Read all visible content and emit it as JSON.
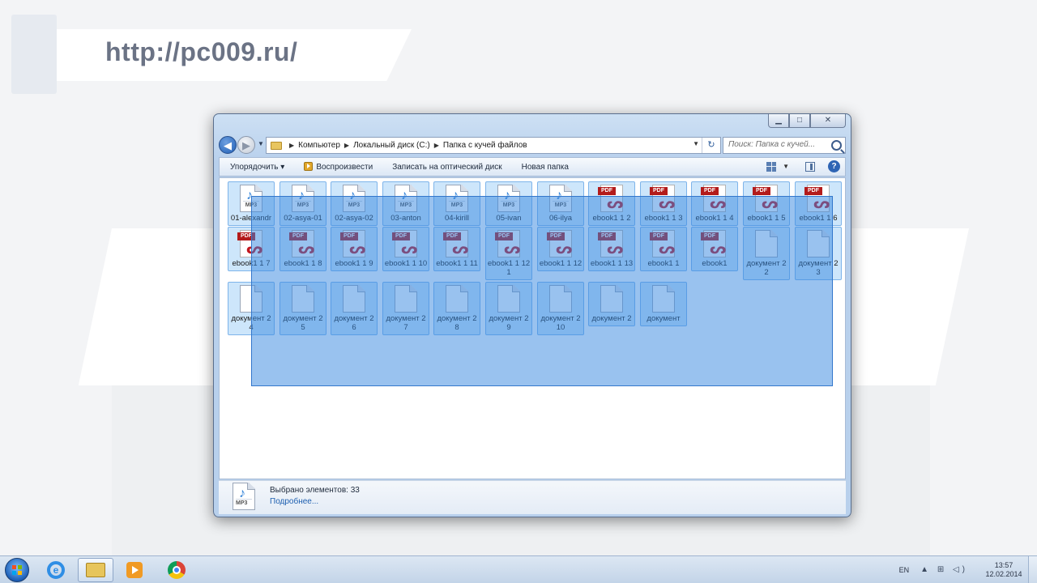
{
  "banner": {
    "url": "http://pc009.ru/"
  },
  "window": {
    "caption_buttons": {
      "minimize": "▁",
      "maximize": "□",
      "close": "✕"
    },
    "nav": {
      "back": "◀",
      "forward": "▶"
    },
    "address": {
      "crumbs": [
        "Компьютер",
        "Локальный диск (C:)",
        "Папка с кучей файлов"
      ],
      "separator": "▶",
      "dropdown": "▼",
      "refresh": "↻"
    },
    "search": {
      "placeholder": "Поиск: Папка с кучей..."
    },
    "toolbar": {
      "organize": "Упорядочить ▾",
      "play": "Воспроизвести",
      "burn": "Записать на оптический диск",
      "new_folder": "Новая папка",
      "help": "?",
      "view_dd": "▼"
    },
    "files": [
      {
        "name": "01-alexandr",
        "type": "mp3"
      },
      {
        "name": "02-asya-01",
        "type": "mp3"
      },
      {
        "name": "02-asya-02",
        "type": "mp3"
      },
      {
        "name": "03-anton",
        "type": "mp3"
      },
      {
        "name": "04-kirill",
        "type": "mp3"
      },
      {
        "name": "05-ivan",
        "type": "mp3"
      },
      {
        "name": "06-ilya",
        "type": "mp3"
      },
      {
        "name": "ebook1 1 2",
        "type": "pdf"
      },
      {
        "name": "ebook1 1 3",
        "type": "pdf"
      },
      {
        "name": "ebook1 1 4",
        "type": "pdf"
      },
      {
        "name": "ebook1 1 5",
        "type": "pdf"
      },
      {
        "name": "ebook1 1 6",
        "type": "pdf"
      },
      {
        "name": "ebook1 1 7",
        "type": "pdf"
      },
      {
        "name": "ebook1 1 8",
        "type": "pdf"
      },
      {
        "name": "ebook1 1 9",
        "type": "pdf"
      },
      {
        "name": "ebook1 1 10",
        "type": "pdf"
      },
      {
        "name": "ebook1 1 11",
        "type": "pdf"
      },
      {
        "name": "ebook1 1 12 1",
        "type": "pdf"
      },
      {
        "name": "ebook1 1 12",
        "type": "pdf"
      },
      {
        "name": "ebook1 1 13",
        "type": "pdf"
      },
      {
        "name": "ebook1 1",
        "type": "pdf"
      },
      {
        "name": "ebook1",
        "type": "pdf"
      },
      {
        "name": "документ 2 2",
        "type": "doc"
      },
      {
        "name": "документ 2 3",
        "type": "doc"
      },
      {
        "name": "документ 2 4",
        "type": "doc"
      },
      {
        "name": "документ 2 5",
        "type": "doc"
      },
      {
        "name": "документ 2 6",
        "type": "doc"
      },
      {
        "name": "документ 2 7",
        "type": "doc"
      },
      {
        "name": "документ 2 8",
        "type": "doc"
      },
      {
        "name": "документ 2 9",
        "type": "doc"
      },
      {
        "name": "документ 2 10",
        "type": "doc"
      },
      {
        "name": "документ 2",
        "type": "doc"
      },
      {
        "name": "документ",
        "type": "doc"
      }
    ],
    "icon_labels": {
      "mp3": "MP3",
      "pdf": "PDF",
      "note": "♪",
      "acro": "ᔕ"
    },
    "details": {
      "selected": "Выбрано элементов: 33",
      "more": "Подробнее...",
      "icon_label": "MP3"
    }
  },
  "taskbar": {
    "ie_letter": "e",
    "language": "EN",
    "tray_icons": "▲ ⊞ ◁)",
    "time": "13:57",
    "date": "12.02.2014"
  }
}
